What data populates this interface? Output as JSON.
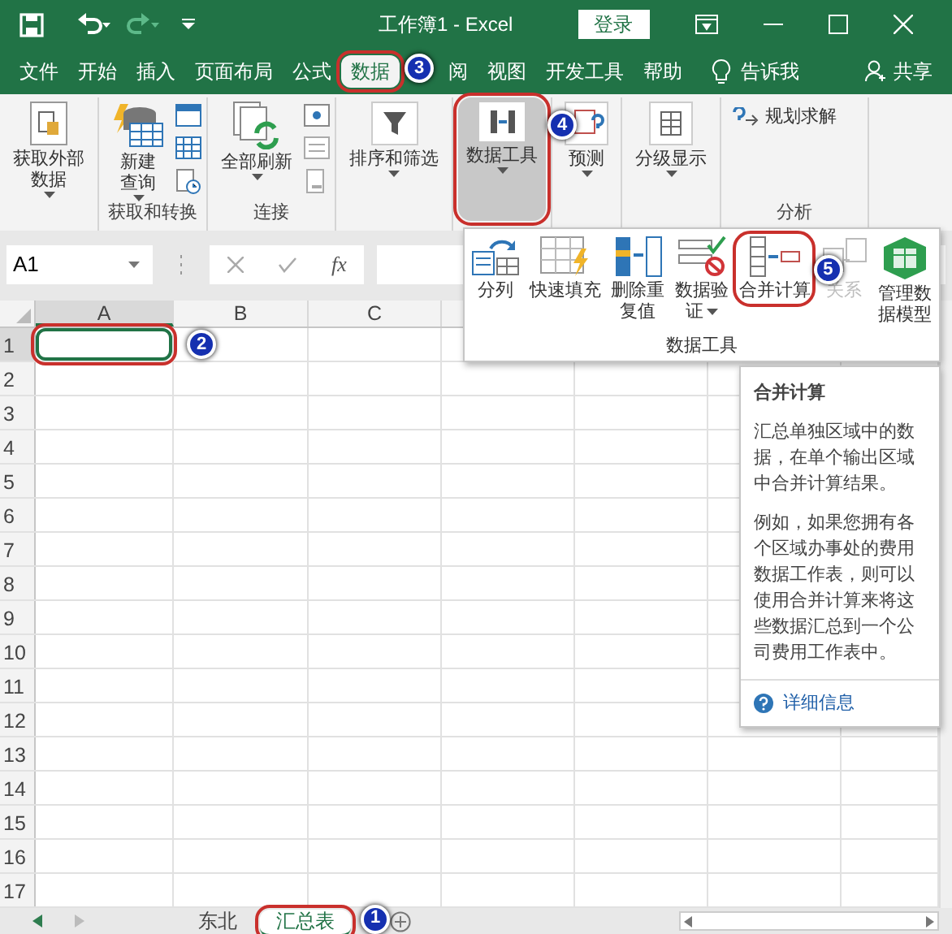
{
  "title_bar": {
    "title": "工作簿1 - Excel",
    "sign_in": "登录"
  },
  "tabs": [
    {
      "label": "文件",
      "selected": false,
      "outlined": false
    },
    {
      "label": "开始",
      "selected": false,
      "outlined": false
    },
    {
      "label": "插入",
      "selected": false,
      "outlined": false
    },
    {
      "label": "页面布局",
      "selected": false,
      "outlined": false
    },
    {
      "label": "公式",
      "selected": false,
      "outlined": false
    },
    {
      "label": "数据",
      "selected": true,
      "outlined": true,
      "badge": "3"
    },
    {
      "label": "阅",
      "selected": false,
      "outlined": false
    },
    {
      "label": "视图",
      "selected": false,
      "outlined": false
    },
    {
      "label": "开发工具",
      "selected": false,
      "outlined": false
    },
    {
      "label": "帮助",
      "selected": false,
      "outlined": false
    }
  ],
  "tell_me": "告诉我",
  "share": "共享",
  "ribbon": {
    "groups": [
      {
        "buttons": [
          {
            "kind": "large",
            "label": "获取外部数据",
            "dropdown": true,
            "pressed": false,
            "outlined": false
          }
        ]
      },
      {
        "label": "获取和转换",
        "buttons": [
          {
            "kind": "large",
            "label": "新建查询",
            "dropdown": true,
            "pressed": false,
            "outlined": false
          },
          {
            "kind": "icon"
          },
          {
            "kind": "icon"
          },
          {
            "kind": "icon"
          }
        ]
      },
      {
        "label": "连接",
        "buttons": [
          {
            "kind": "large",
            "label": "全部刷新",
            "dropdown": true,
            "pressed": false,
            "outlined": false
          },
          {
            "kind": "icon"
          },
          {
            "kind": "icon"
          },
          {
            "kind": "icon"
          }
        ]
      },
      {
        "buttons": [
          {
            "kind": "large",
            "label": "排序和筛选",
            "dropdown": true,
            "pressed": false,
            "outlined": false
          }
        ]
      },
      {
        "buttons": [
          {
            "kind": "large",
            "label": "数据工具",
            "dropdown": true,
            "pressed": true,
            "outlined": true
          }
        ]
      },
      {
        "buttons": [
          {
            "kind": "large",
            "label": "预测",
            "dropdown": true,
            "pressed": false,
            "outlined": false,
            "badge": "4"
          }
        ]
      },
      {
        "buttons": [
          {
            "kind": "large",
            "label": "分级显示",
            "dropdown": true,
            "pressed": false,
            "outlined": false
          }
        ]
      },
      {
        "label": "分析",
        "buttons": [
          {
            "kind": "small",
            "label": "规划求解"
          }
        ]
      }
    ]
  },
  "formula_bar": {
    "name_box": "A1",
    "function_label": "fx"
  },
  "grid": {
    "columns": [
      "A",
      "B",
      "C"
    ],
    "rows": [
      "1",
      "2",
      "3",
      "4",
      "5",
      "6",
      "7",
      "8",
      "9",
      "10",
      "11",
      "12",
      "13",
      "14",
      "15",
      "16",
      "17"
    ],
    "selected_cell": {
      "outlined": true,
      "badge": "2"
    }
  },
  "data_tools_panel": {
    "label": "数据工具",
    "buttons": [
      {
        "label": "分列",
        "dropdown": false,
        "disabled": false,
        "outlined": false
      },
      {
        "label": "快速填充",
        "dropdown": false,
        "disabled": false,
        "outlined": false
      },
      {
        "label": "删除重复值",
        "dropdown": false,
        "disabled": false,
        "outlined": false
      },
      {
        "label": "数据验证",
        "dropdown": true,
        "disabled": false,
        "outlined": false
      },
      {
        "label": "合并计算",
        "dropdown": false,
        "disabled": false,
        "outlined": true
      },
      {
        "label": "关系",
        "dropdown": false,
        "disabled": true,
        "outlined": false,
        "badge": "5"
      },
      {
        "label": "管理数据模型",
        "dropdown": false,
        "disabled": false,
        "outlined": false
      }
    ]
  },
  "tooltip": {
    "title": "合并计算",
    "paragraphs": [
      "汇总单独区域中的数据，在单个输出区域中合并计算结果。",
      "例如，如果您拥有各个区域办事处的费用数据工作表，则可以使用合并计算来将这些数据汇总到一个公司费用工作表中。"
    ],
    "link": "详细信息"
  },
  "sheet_tabs": [
    {
      "label": "东北",
      "selected": false,
      "outlined": false
    },
    {
      "label": "汇总表",
      "selected": true,
      "outlined": true,
      "badge": "1"
    }
  ]
}
